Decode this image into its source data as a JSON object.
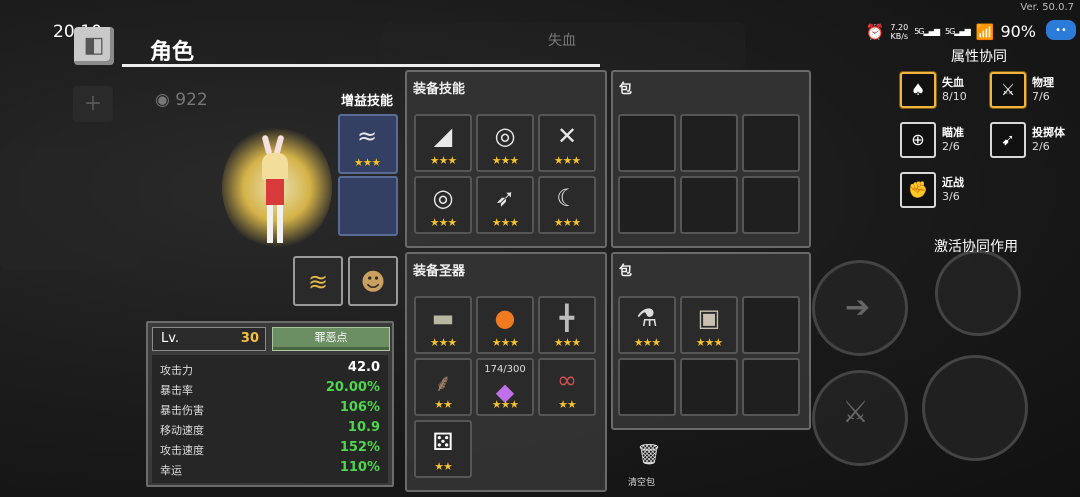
{
  "status_bar": {
    "time": "20:10",
    "net_speed_value": "7.20",
    "net_speed_unit": "KB/s",
    "sim1": "5G",
    "sim2": "5G",
    "battery": "90%",
    "version": "Ver. 50.0.7"
  },
  "header": {
    "title": "角色",
    "gold": "922"
  },
  "background_overlay": {
    "tooltip_title": "失血"
  },
  "buff_skills": {
    "label": "增益技能",
    "slots": [
      {
        "icon": "wind-slash-icon",
        "glyph": "≈",
        "stars": "★★★"
      },
      {
        "icon": "empty-slot",
        "glyph": "",
        "stars": ""
      }
    ]
  },
  "equipped_skills": {
    "title": "装备技能",
    "slots": [
      {
        "icon": "blade-strike-icon",
        "glyph": "◢",
        "stars": "★★★"
      },
      {
        "icon": "orbit-slash-icon",
        "glyph": "◎",
        "stars": "★★★"
      },
      {
        "icon": "cross-slash-icon",
        "glyph": "✕",
        "stars": "★★★"
      },
      {
        "icon": "orbit-slash-icon",
        "glyph": "◎",
        "stars": "★★★"
      },
      {
        "icon": "feather-slash-icon",
        "glyph": "➶",
        "stars": "★★★"
      },
      {
        "icon": "crescent-slash-icon",
        "glyph": "☾",
        "stars": "★★★"
      }
    ]
  },
  "bag_top": {
    "title": "包"
  },
  "equipped_relics": {
    "title": "装备圣器",
    "slots": [
      {
        "icon": "barrel-icon",
        "glyph": "▬",
        "stars": "★★★",
        "count": ""
      },
      {
        "icon": "fire-orb-icon",
        "glyph": "●",
        "stars": "★★★",
        "count": ""
      },
      {
        "icon": "dumbbell-icon",
        "glyph": "╋",
        "stars": "★★★",
        "count": ""
      },
      {
        "icon": "twig-icon",
        "glyph": "⸙",
        "stars": "★★",
        "count": ""
      },
      {
        "icon": "purple-gem-icon",
        "glyph": "◆",
        "stars": "★★★",
        "count": "174/300"
      },
      {
        "icon": "glasses-icon",
        "glyph": "∞",
        "stars": "★★",
        "count": ""
      },
      {
        "icon": "dice-icon",
        "glyph": "⚄",
        "stars": "★★",
        "count": ""
      }
    ]
  },
  "bag_bottom": {
    "title": "包",
    "slots": [
      {
        "icon": "potion-flask-icon",
        "glyph": "⚗",
        "stars": "★★★"
      },
      {
        "icon": "stone-dice-icon",
        "glyph": "▣",
        "stars": "★★★"
      }
    ]
  },
  "equipment_row": [
    {
      "icon": "golden-wing-icon",
      "glyph": "≋"
    },
    {
      "icon": "mask-icon",
      "glyph": "☻"
    }
  ],
  "stats": {
    "level_label": "Lv.",
    "level_value": "30",
    "sin_button": "罪恶点",
    "rows": [
      {
        "label": "攻击力",
        "value": "42.0",
        "color": "#ffffff"
      },
      {
        "label": "暴击率",
        "value": "20.00%",
        "color": "#4fd64f"
      },
      {
        "label": "暴击伤害",
        "value": "106%",
        "color": "#4fd64f"
      },
      {
        "label": "移动速度",
        "value": "10.9",
        "color": "#4fd64f"
      },
      {
        "label": "攻击速度",
        "value": "152%",
        "color": "#4fd64f"
      },
      {
        "label": "幸运",
        "value": "110%",
        "color": "#4fd64f"
      }
    ]
  },
  "synergy": {
    "title": "属性协同",
    "items": [
      {
        "name": "失血",
        "count": "8/10",
        "icon": "blood-drop-icon",
        "glyph": "♠",
        "active": true
      },
      {
        "name": "物理",
        "count": "7/6",
        "icon": "sword-icon",
        "glyph": "⚔",
        "active": true
      },
      {
        "name": "瞄准",
        "count": "2/6",
        "icon": "crosshair-icon",
        "glyph": "⊕",
        "active": false
      },
      {
        "name": "投掷体",
        "count": "2/6",
        "icon": "throw-icon",
        "glyph": "➹",
        "active": false
      },
      {
        "name": "近战",
        "count": "3/6",
        "icon": "fist-icon",
        "glyph": "✊",
        "active": false
      }
    ],
    "activate_label": "激活协同作用"
  },
  "clear_bag": {
    "label": "清空包"
  },
  "colors": {
    "star": "#f2c230",
    "stat_green": "#4fd64f",
    "level_gold": "#f3c243",
    "buff_slot_blue": "#334063"
  }
}
